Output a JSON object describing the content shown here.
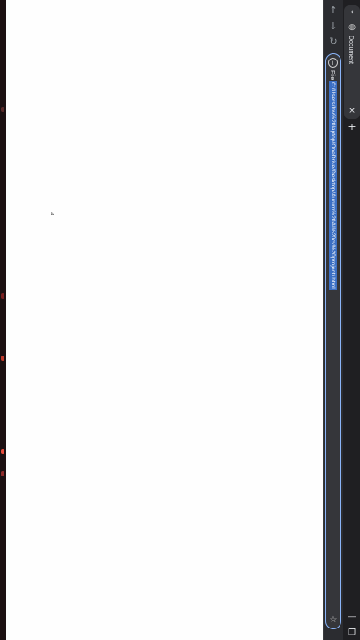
{
  "window": {
    "tab_title": "Document",
    "new_tab_symbol": "+",
    "close_tab_symbol": "×"
  },
  "address_bar": {
    "scheme_label": "File",
    "url": "C:/Users/Inv%20laptop/OneDrive/Desktop/Aurum%20AI%20cv%20project/.html"
  },
  "page": {
    "cursor_text": "⊿"
  },
  "icons": {
    "back": "back-arrow-icon",
    "forward": "forward-arrow-icon",
    "reload": "reload-icon",
    "info": "info-icon",
    "star": "star-icon",
    "favicon": "globe-icon",
    "minimize": "minimize-icon",
    "restore": "restore-icon"
  },
  "colors": {
    "chrome_bg": "#202124",
    "omnibox_focus": "#8ab4f8",
    "url_highlight": "#3b6fc4"
  }
}
